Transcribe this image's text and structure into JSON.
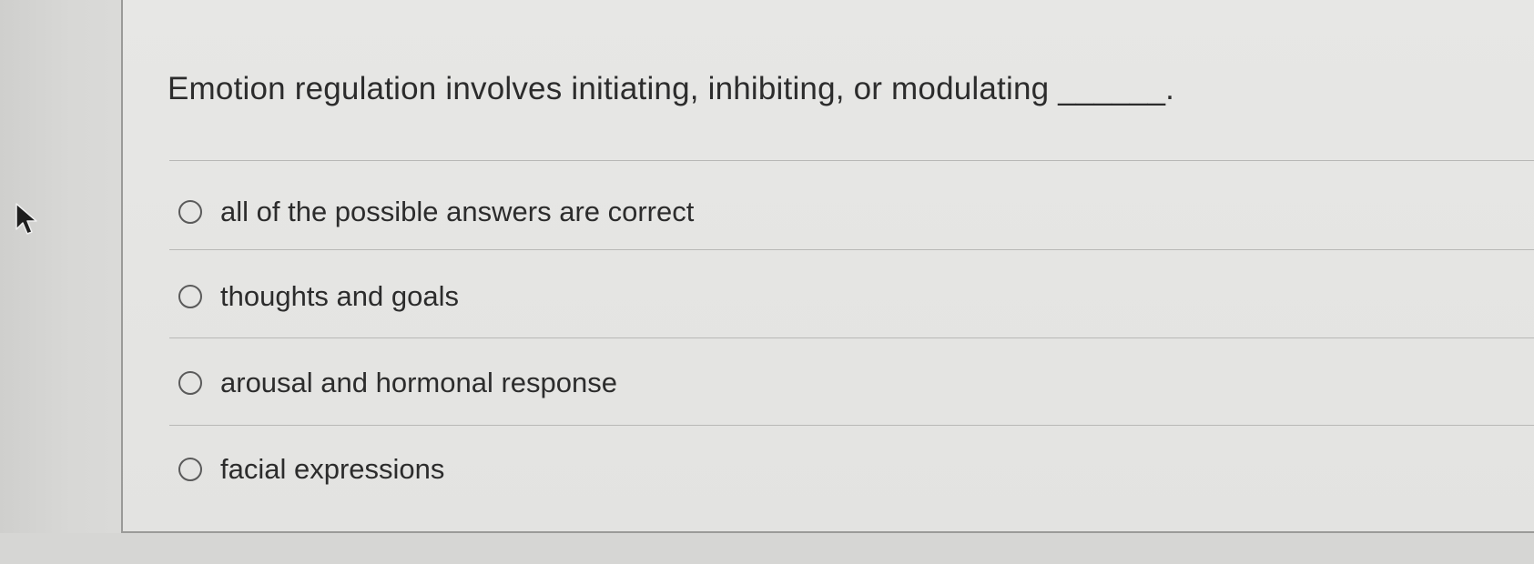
{
  "question": {
    "text": "Emotion regulation involves initiating, inhibiting, or modulating ______."
  },
  "choices": [
    {
      "label": "all of the possible answers are correct",
      "selected": false
    },
    {
      "label": "thoughts and goals",
      "selected": false
    },
    {
      "label": "arousal and hormonal response",
      "selected": false
    },
    {
      "label": "facial expressions",
      "selected": false
    }
  ],
  "icons": {
    "cursor": "mouse-pointer-icon",
    "radio": "radio-button-unselected-icon"
  }
}
